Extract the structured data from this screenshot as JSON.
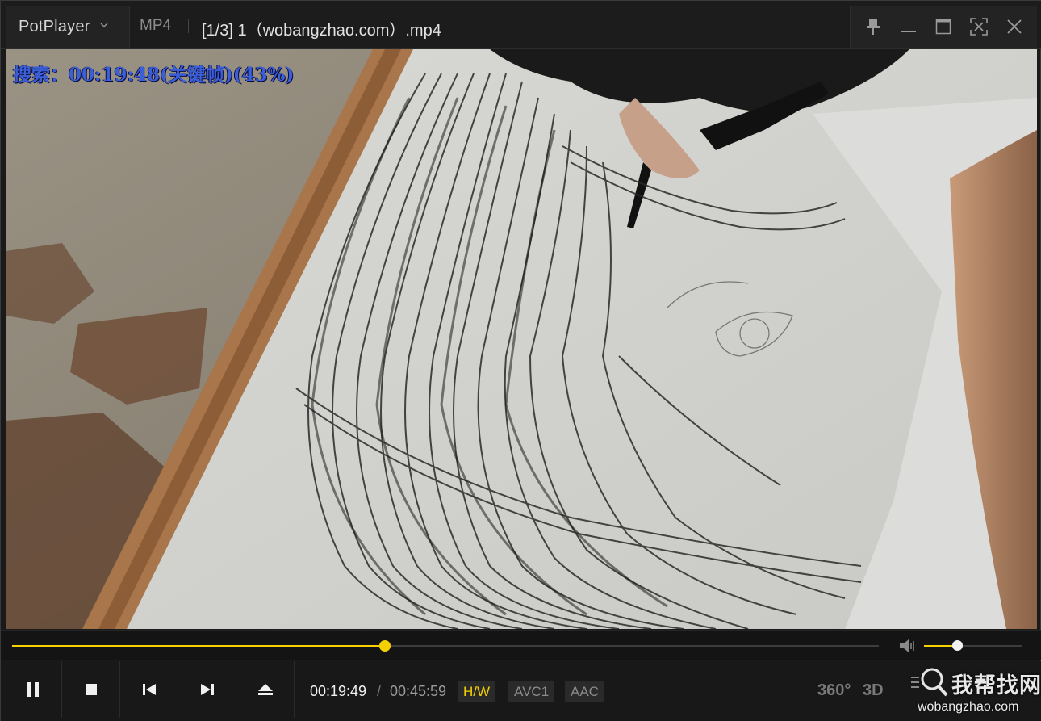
{
  "titlebar": {
    "app_name": "PotPlayer",
    "format": "MP4",
    "file_title": "[1/3] 1（wobangzhao.com）.mp4"
  },
  "osd": {
    "text": "搜索：00:19:48(关键帧)(43%)"
  },
  "playback": {
    "progress": 0.43,
    "volume": 0.34,
    "current_time": "00:19:49",
    "separator": "/",
    "total_time": "00:45:59"
  },
  "badges": {
    "hw": "H/W",
    "video_codec": "AVC1",
    "audio_codec": "AAC"
  },
  "right_icons": {
    "vr": "360°",
    "three_d": "3D"
  },
  "watermark": {
    "title": "我帮找网",
    "url": "wobangzhao.com"
  },
  "colors": {
    "accent": "#f5d000",
    "osd": "#3b5fd6",
    "background": "#181818"
  }
}
